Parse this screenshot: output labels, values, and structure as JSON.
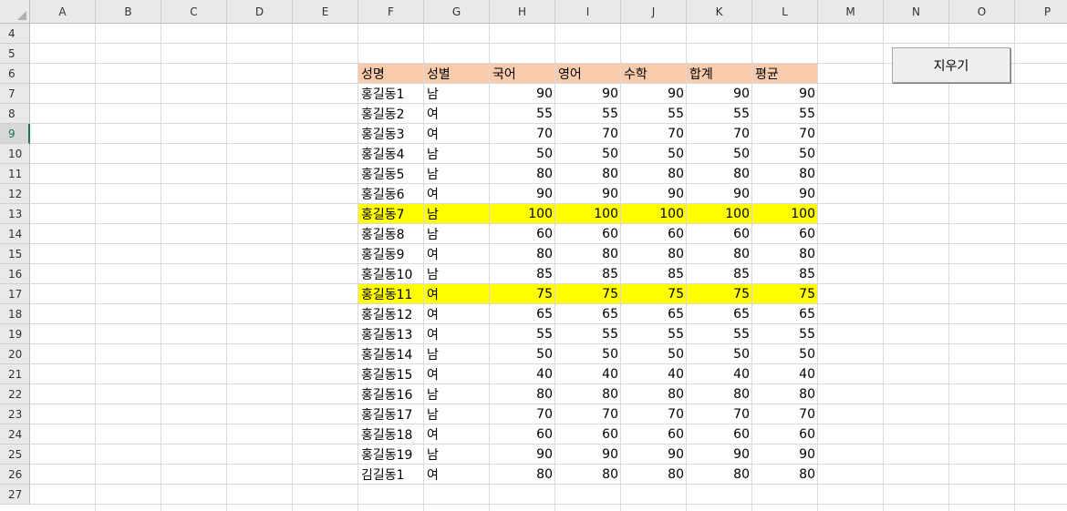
{
  "columns": [
    "A",
    "B",
    "C",
    "D",
    "E",
    "F",
    "G",
    "H",
    "I",
    "J",
    "K",
    "L",
    "M",
    "N",
    "O",
    "P"
  ],
  "rows": [
    "4",
    "5",
    "6",
    "7",
    "8",
    "9",
    "10",
    "11",
    "12",
    "13",
    "14",
    "15",
    "16",
    "17",
    "18",
    "19",
    "20",
    "21",
    "22",
    "23",
    "24",
    "25",
    "26",
    "27"
  ],
  "active_row": "9",
  "header_fill": "#F8CBAD",
  "highlight_fill": "#FFFF00",
  "table": {
    "headers": [
      "성명",
      "성별",
      "국어",
      "영어",
      "수학",
      "합계",
      "평균"
    ],
    "records": [
      {
        "name": "홍길동1",
        "gender": "남",
        "kor": "90",
        "eng": "90",
        "math": "90",
        "total": "90",
        "avg": "90",
        "highlight": false
      },
      {
        "name": "홍길동2",
        "gender": "여",
        "kor": "55",
        "eng": "55",
        "math": "55",
        "total": "55",
        "avg": "55",
        "highlight": false
      },
      {
        "name": "홍길동3",
        "gender": "여",
        "kor": "70",
        "eng": "70",
        "math": "70",
        "total": "70",
        "avg": "70",
        "highlight": false
      },
      {
        "name": "홍길동4",
        "gender": "남",
        "kor": "50",
        "eng": "50",
        "math": "50",
        "total": "50",
        "avg": "50",
        "highlight": false
      },
      {
        "name": "홍길동5",
        "gender": "남",
        "kor": "80",
        "eng": "80",
        "math": "80",
        "total": "80",
        "avg": "80",
        "highlight": false
      },
      {
        "name": "홍길동6",
        "gender": "여",
        "kor": "90",
        "eng": "90",
        "math": "90",
        "total": "90",
        "avg": "90",
        "highlight": false
      },
      {
        "name": "홍길동7",
        "gender": "남",
        "kor": "100",
        "eng": "100",
        "math": "100",
        "total": "100",
        "avg": "100",
        "highlight": true
      },
      {
        "name": "홍길동8",
        "gender": "남",
        "kor": "60",
        "eng": "60",
        "math": "60",
        "total": "60",
        "avg": "60",
        "highlight": false
      },
      {
        "name": "홍길동9",
        "gender": "여",
        "kor": "80",
        "eng": "80",
        "math": "80",
        "total": "80",
        "avg": "80",
        "highlight": false
      },
      {
        "name": "홍길동10",
        "gender": "남",
        "kor": "85",
        "eng": "85",
        "math": "85",
        "total": "85",
        "avg": "85",
        "highlight": false
      },
      {
        "name": "홍길동11",
        "gender": "여",
        "kor": "75",
        "eng": "75",
        "math": "75",
        "total": "75",
        "avg": "75",
        "highlight": true
      },
      {
        "name": "홍길동12",
        "gender": "여",
        "kor": "65",
        "eng": "65",
        "math": "65",
        "total": "65",
        "avg": "65",
        "highlight": false
      },
      {
        "name": "홍길동13",
        "gender": "여",
        "kor": "55",
        "eng": "55",
        "math": "55",
        "total": "55",
        "avg": "55",
        "highlight": false
      },
      {
        "name": "홍길동14",
        "gender": "남",
        "kor": "50",
        "eng": "50",
        "math": "50",
        "total": "50",
        "avg": "50",
        "highlight": false
      },
      {
        "name": "홍길동15",
        "gender": "여",
        "kor": "40",
        "eng": "40",
        "math": "40",
        "total": "40",
        "avg": "40",
        "highlight": false
      },
      {
        "name": "홍길동16",
        "gender": "남",
        "kor": "80",
        "eng": "80",
        "math": "80",
        "total": "80",
        "avg": "80",
        "highlight": false
      },
      {
        "name": "홍길동17",
        "gender": "남",
        "kor": "70",
        "eng": "70",
        "math": "70",
        "total": "70",
        "avg": "70",
        "highlight": false
      },
      {
        "name": "홍길동18",
        "gender": "여",
        "kor": "60",
        "eng": "60",
        "math": "60",
        "total": "60",
        "avg": "60",
        "highlight": false
      },
      {
        "name": "홍길동19",
        "gender": "남",
        "kor": "90",
        "eng": "90",
        "math": "90",
        "total": "90",
        "avg": "90",
        "highlight": false
      },
      {
        "name": "김길동1",
        "gender": "여",
        "kor": "80",
        "eng": "80",
        "math": "80",
        "total": "80",
        "avg": "80",
        "highlight": false
      }
    ]
  },
  "button": {
    "label": "지우기"
  }
}
